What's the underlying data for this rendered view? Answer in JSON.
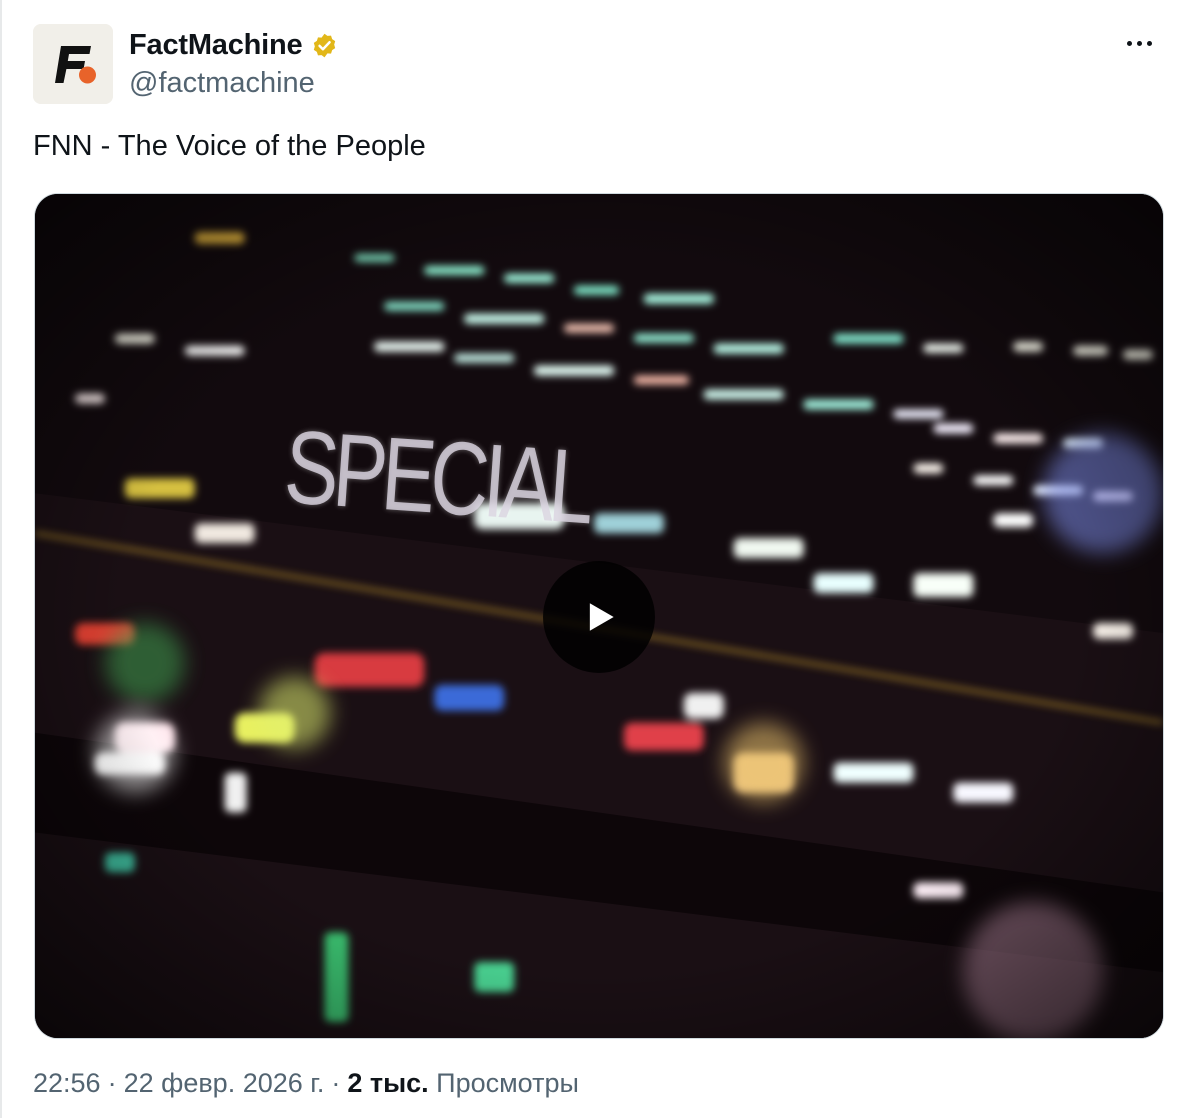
{
  "author": {
    "display_name": "FactMachine",
    "handle": "@factmachine",
    "verified": true,
    "verified_color": "#e2b719",
    "avatar_icon": "factmachine-logo-icon",
    "avatar_accent": "#e8632a"
  },
  "more_icon": "more-horizontal-icon",
  "tweet": {
    "text": "FNN - The Voice of the People"
  },
  "media": {
    "type": "video",
    "frame_title": "SPECIAL",
    "play_icon": "play-icon"
  },
  "meta": {
    "time": "22:56",
    "date": "22 февр. 2026 г.",
    "separator": "·",
    "views_count": "2 тыс.",
    "views_label": "Просмотры"
  }
}
